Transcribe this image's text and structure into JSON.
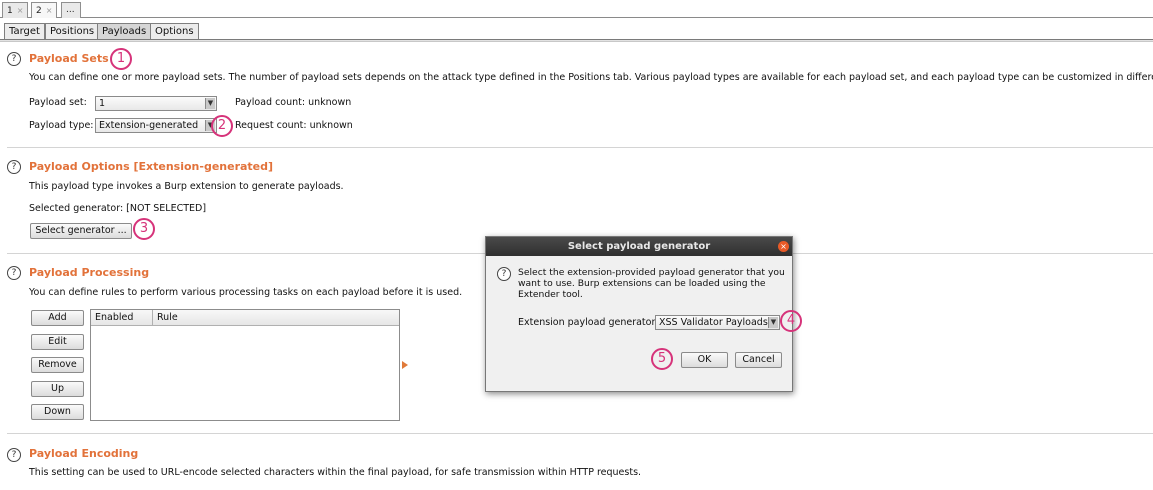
{
  "attack_tabs": [
    {
      "label": "1",
      "close": "×"
    },
    {
      "label": "2",
      "close": "×"
    },
    {
      "label": "..."
    }
  ],
  "sub_tabs": [
    "Target",
    "Positions",
    "Payloads",
    "Options"
  ],
  "help_glyph": "?",
  "payload_sets": {
    "title": "Payload Sets",
    "description": "You can define one or more payload sets. The number of payload sets depends on the attack type defined in the Positions tab. Various payload types are available for each payload set, and each payload type can be customized in different ways.",
    "set_label": "Payload set:",
    "set_value": "1",
    "type_label": "Payload type:",
    "type_value": "Extension-generated",
    "payload_count": "Payload count: unknown",
    "request_count": "Request count: unknown"
  },
  "payload_options": {
    "title": "Payload Options [Extension-generated]",
    "description": "This payload type invokes a Burp extension to generate payloads.",
    "selected_generator": "Selected generator: [NOT SELECTED]",
    "select_button": "Select generator ..."
  },
  "payload_processing": {
    "title": "Payload Processing",
    "description": "You can define rules to perform various processing tasks on each payload before it is used.",
    "buttons": [
      "Add",
      "Edit",
      "Remove",
      "Up",
      "Down"
    ],
    "columns": [
      "Enabled",
      "Rule"
    ]
  },
  "payload_encoding": {
    "title": "Payload Encoding",
    "description": "This setting can be used to URL-encode selected characters within the final payload, for safe transmission within HTTP requests."
  },
  "dialog": {
    "title": "Select payload generator",
    "close": "×",
    "message": "Select the extension-provided payload generator that you want to use. Burp extensions can be loaded using the Extender tool.",
    "generator_label": "Extension payload generator:",
    "generator_value": "XSS Validator Payloads",
    "ok": "OK",
    "cancel": "Cancel"
  },
  "markers": [
    "1",
    "2",
    "3",
    "4",
    "5"
  ],
  "colors": {
    "section_title": "#e2723a",
    "marker": "#d6337a",
    "dialog_close": "#e85a27"
  }
}
